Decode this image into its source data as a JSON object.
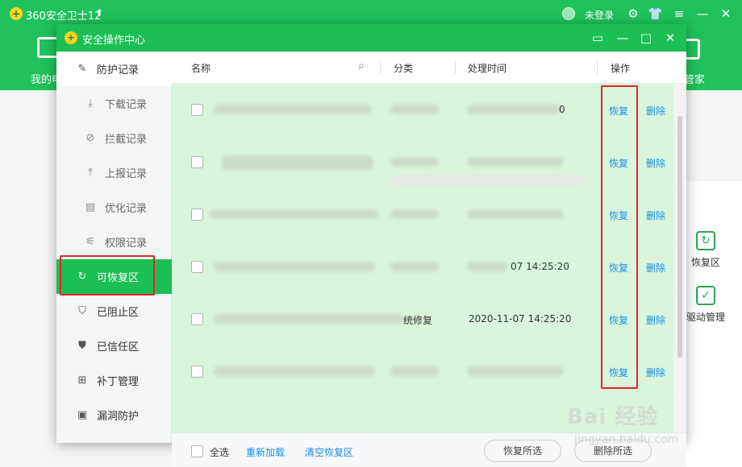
{
  "background": {
    "app_title": "360安全卫士12",
    "login": "未登录",
    "nav_left": "我的电",
    "nav_right": "管家",
    "tools": [
      {
        "label": "恢复区",
        "icon": "refresh-icon"
      },
      {
        "label": "驱动管理",
        "icon": "checkbox-icon"
      }
    ]
  },
  "dialog": {
    "title": "安全操作中心",
    "sidebar": [
      {
        "label": "防护记录",
        "icon": "edit-icon",
        "type": "head"
      },
      {
        "label": "下载记录",
        "icon": "download-icon",
        "type": "sub"
      },
      {
        "label": "拦截记录",
        "icon": "block-icon",
        "type": "sub"
      },
      {
        "label": "上报记录",
        "icon": "upload-icon",
        "type": "sub"
      },
      {
        "label": "优化记录",
        "icon": "document-icon",
        "type": "sub"
      },
      {
        "label": "权限记录",
        "icon": "sliders-icon",
        "type": "sub"
      },
      {
        "label": "可恢复区",
        "icon": "refresh-icon",
        "type": "active"
      },
      {
        "label": "已阻止区",
        "icon": "shield-alert-icon",
        "type": "normal"
      },
      {
        "label": "已信任区",
        "icon": "shield-check-icon",
        "type": "normal"
      },
      {
        "label": "补丁管理",
        "icon": "grid-icon",
        "type": "normal"
      },
      {
        "label": "漏洞防护",
        "icon": "monitor-icon",
        "type": "normal"
      }
    ],
    "table": {
      "columns": {
        "name": "名称",
        "category": "分类",
        "time": "处理时间",
        "action": "操作"
      },
      "rows": [
        {
          "category": "",
          "time": "0",
          "restore": "恢复",
          "delete": "删除"
        },
        {
          "category": "",
          "time": "",
          "restore": "恢复",
          "delete": "删除"
        },
        {
          "category": "",
          "time": "",
          "restore": "恢复",
          "delete": "删除"
        },
        {
          "category": "",
          "time": "07 14:25:20",
          "restore": "恢复",
          "delete": "删除"
        },
        {
          "category": "统修复",
          "time": "2020-11-07 14:25:20",
          "restore": "恢复",
          "delete": "删除"
        },
        {
          "category": "",
          "time": "",
          "restore": "恢复",
          "delete": "删除"
        }
      ]
    },
    "footer": {
      "select_all": "全选",
      "reload": "重新加载",
      "clear": "清空恢复区",
      "restore_selected": "恢复所选",
      "delete_selected": "删除所选"
    }
  },
  "colors": {
    "green": "#1bbf55",
    "row_bg": "#d9f5dc",
    "link": "#1a8fe6",
    "highlight": "#e52323"
  },
  "watermark": {
    "text": "Bai 经验",
    "url": "jingyan.baidu.com"
  }
}
